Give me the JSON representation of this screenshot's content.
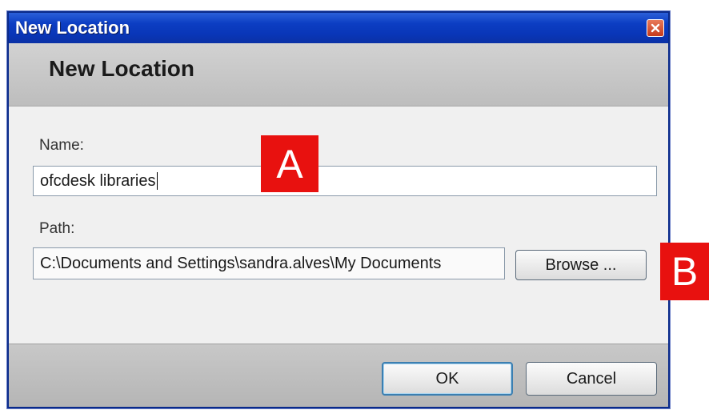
{
  "window": {
    "title": "New Location",
    "close_icon": "close-icon"
  },
  "header": {
    "title": "New Location"
  },
  "form": {
    "name_label": "Name:",
    "name_value": "ofcdesk libraries",
    "path_label": "Path:",
    "path_value": "C:\\Documents and Settings\\sandra.alves\\My Documents",
    "browse_label": "Browse ..."
  },
  "footer": {
    "ok_label": "OK",
    "cancel_label": "Cancel"
  },
  "annotations": {
    "marker_a": "A",
    "marker_b": "B",
    "marker_color": "#e8110f"
  }
}
